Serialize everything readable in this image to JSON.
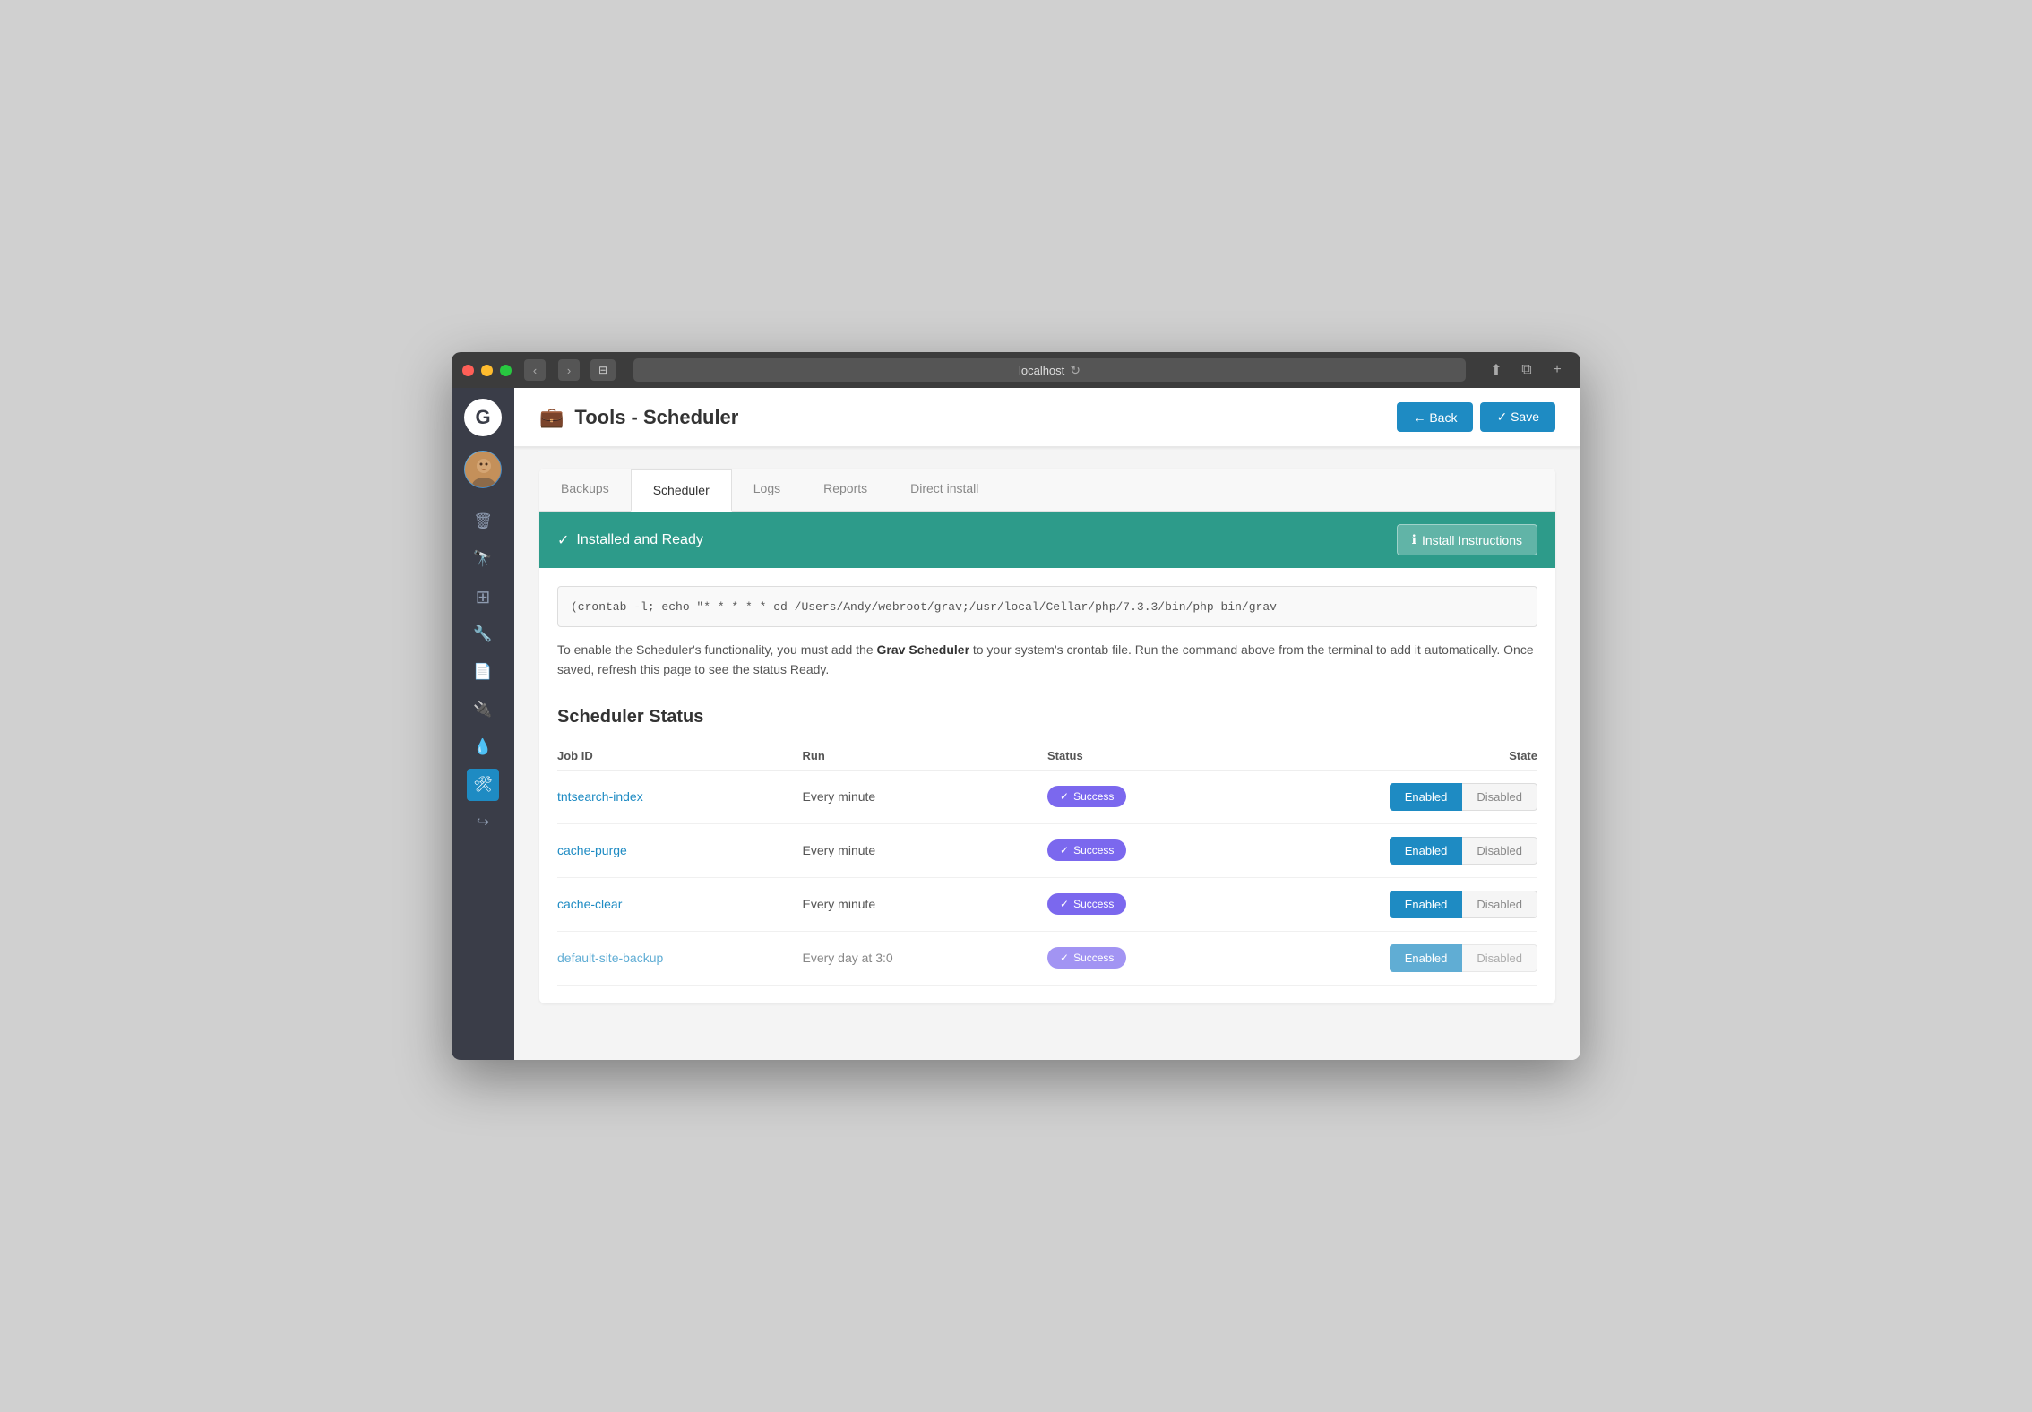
{
  "browser": {
    "address": "localhost",
    "reload_icon": "↻"
  },
  "header": {
    "icon": "💼",
    "title": "Tools - Scheduler",
    "back_label": "← Back",
    "save_label": "✓ Save"
  },
  "tabs": [
    {
      "id": "backups",
      "label": "Backups",
      "active": false
    },
    {
      "id": "scheduler",
      "label": "Scheduler",
      "active": true
    },
    {
      "id": "logs",
      "label": "Logs",
      "active": false
    },
    {
      "id": "reports",
      "label": "Reports",
      "active": false
    },
    {
      "id": "direct-install",
      "label": "Direct install",
      "active": false
    }
  ],
  "status_banner": {
    "icon": "✓",
    "text": "Installed and Ready",
    "btn_icon": "ℹ",
    "btn_label": "Install Instructions"
  },
  "crontab": {
    "command": "(crontab -l; echo \"* * * * * cd /Users/Andy/webroot/grav;/usr/local/Cellar/php/7.3.3/bin/php bin/grav",
    "description_prefix": "To enable the Scheduler's functionality, you must add the ",
    "description_bold": "Grav Scheduler",
    "description_suffix": " to your system's crontab file. Run the command above from the terminal to add it automatically. Once saved, refresh this page to see the status Ready."
  },
  "scheduler_status": {
    "title": "Scheduler Status",
    "columns": {
      "job_id": "Job ID",
      "run": "Run",
      "status": "Status",
      "state": "State"
    },
    "jobs": [
      {
        "id": "tntsearch-index",
        "run": "Every minute",
        "status": "Success",
        "enabled": true
      },
      {
        "id": "cache-purge",
        "run": "Every minute",
        "status": "Success",
        "enabled": true
      },
      {
        "id": "cache-clear",
        "run": "Every minute",
        "status": "Success",
        "enabled": true
      },
      {
        "id": "default-site-backup",
        "run": "Every day at 3:0",
        "status": "Success",
        "enabled": true,
        "partial": true
      }
    ]
  },
  "sidebar": {
    "icons": [
      {
        "name": "trash-icon",
        "symbol": "🗑",
        "active": false
      },
      {
        "name": "binoculars-icon",
        "symbol": "🔭",
        "active": false
      },
      {
        "name": "grid-icon",
        "symbol": "⊞",
        "active": false
      },
      {
        "name": "wrench-icon",
        "symbol": "🔧",
        "active": false
      },
      {
        "name": "document-icon",
        "symbol": "📄",
        "active": false
      },
      {
        "name": "plugin-icon",
        "symbol": "🔌",
        "active": false
      },
      {
        "name": "drop-icon",
        "symbol": "💧",
        "active": false
      },
      {
        "name": "tools-icon",
        "symbol": "🛠",
        "active": true
      },
      {
        "name": "export-icon",
        "symbol": "↪",
        "active": false
      }
    ]
  }
}
